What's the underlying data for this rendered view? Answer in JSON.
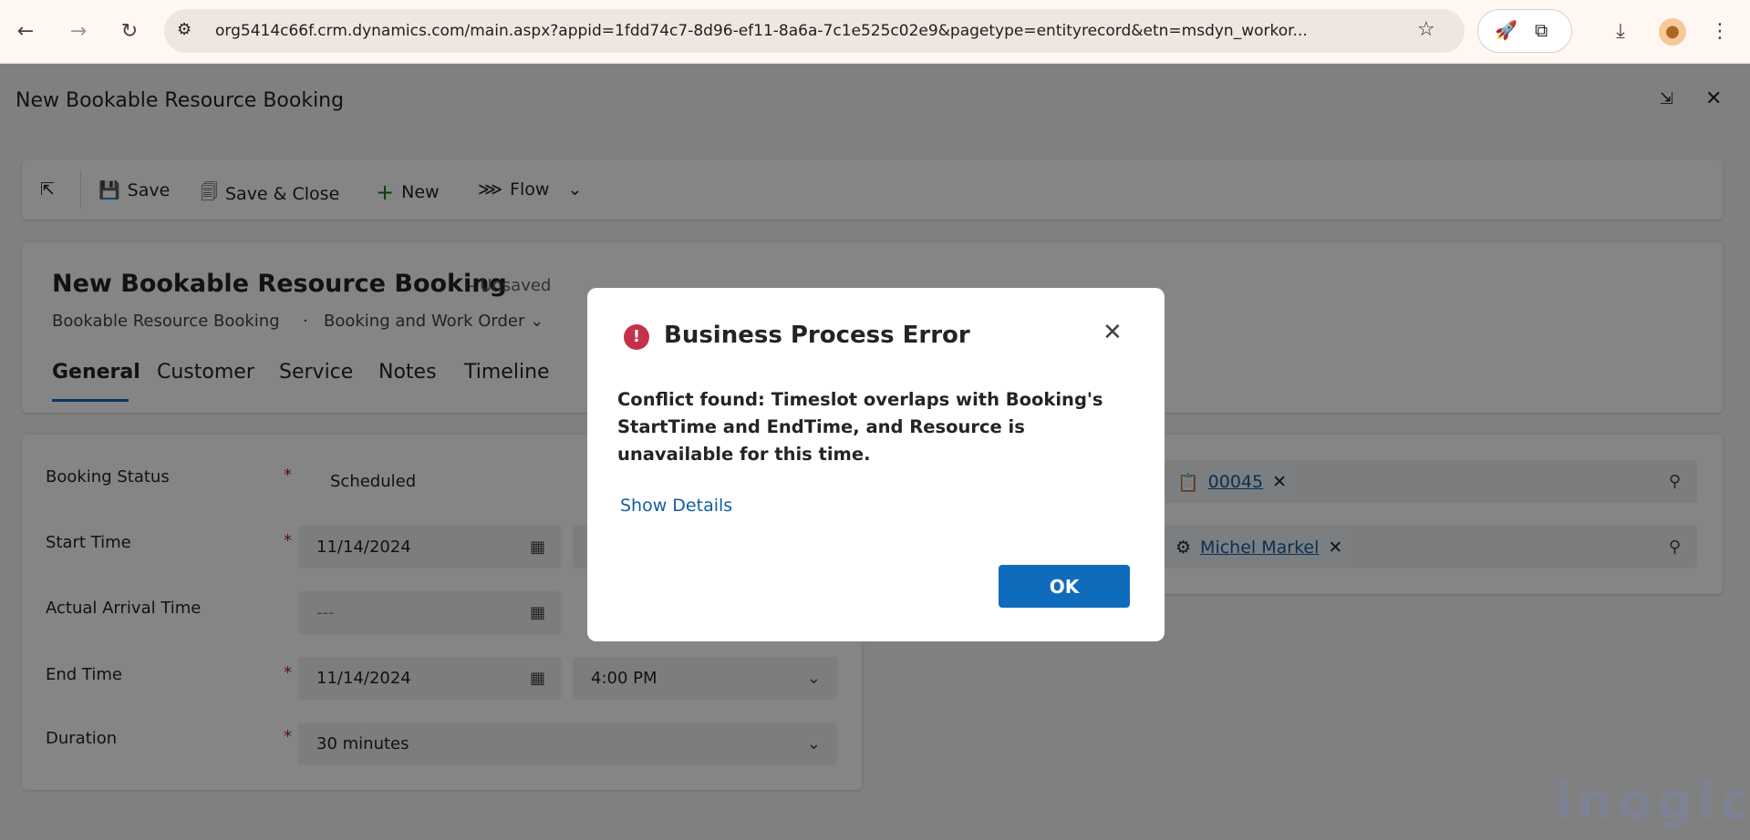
{
  "browser": {
    "url": "org5414c66f.crm.dynamics.com/main.aspx?appid=1fdd74c7-8d96-ef11-8a6a-7c1e525c02e9&pagetype=entityrecord&etn=msdyn_workor..."
  },
  "window": {
    "title": "New Bookable Resource Booking"
  },
  "toolbar": {
    "save": "Save",
    "save_close": "Save & Close",
    "new": "New",
    "flow": "Flow"
  },
  "header": {
    "title": "New Bookable Resource Booking",
    "status": "- Unsaved",
    "entity": "Bookable Resource Booking",
    "separator": "·",
    "form": "Booking and Work Order"
  },
  "tabs": [
    {
      "label": "General",
      "active": true
    },
    {
      "label": "Customer"
    },
    {
      "label": "Service"
    },
    {
      "label": "Notes"
    },
    {
      "label": "Timeline"
    }
  ],
  "form": {
    "booking_status": {
      "label": "Booking Status",
      "value": "Scheduled"
    },
    "start_time": {
      "label": "Start Time",
      "date": "11/14/2024"
    },
    "actual_arrival": {
      "label": "Actual Arrival Time",
      "date": "---"
    },
    "end_time": {
      "label": "End Time",
      "date": "11/14/2024",
      "time": "4:00 PM"
    },
    "duration": {
      "label": "Duration",
      "value": "30 minutes"
    },
    "required": "*"
  },
  "right": {
    "work_order": "00045",
    "resource": "Michel Markel"
  },
  "modal": {
    "title": "Business Process Error",
    "message": "Conflict found: Timeslot overlaps with Booking's StartTime and EndTime, and Resource is unavailable for this time.",
    "details": "Show Details",
    "ok": "OK"
  },
  "watermark": "inogic",
  "colors": {
    "accent": "#0f6cbd",
    "error": "#c4314b",
    "link": "#115ea3"
  }
}
